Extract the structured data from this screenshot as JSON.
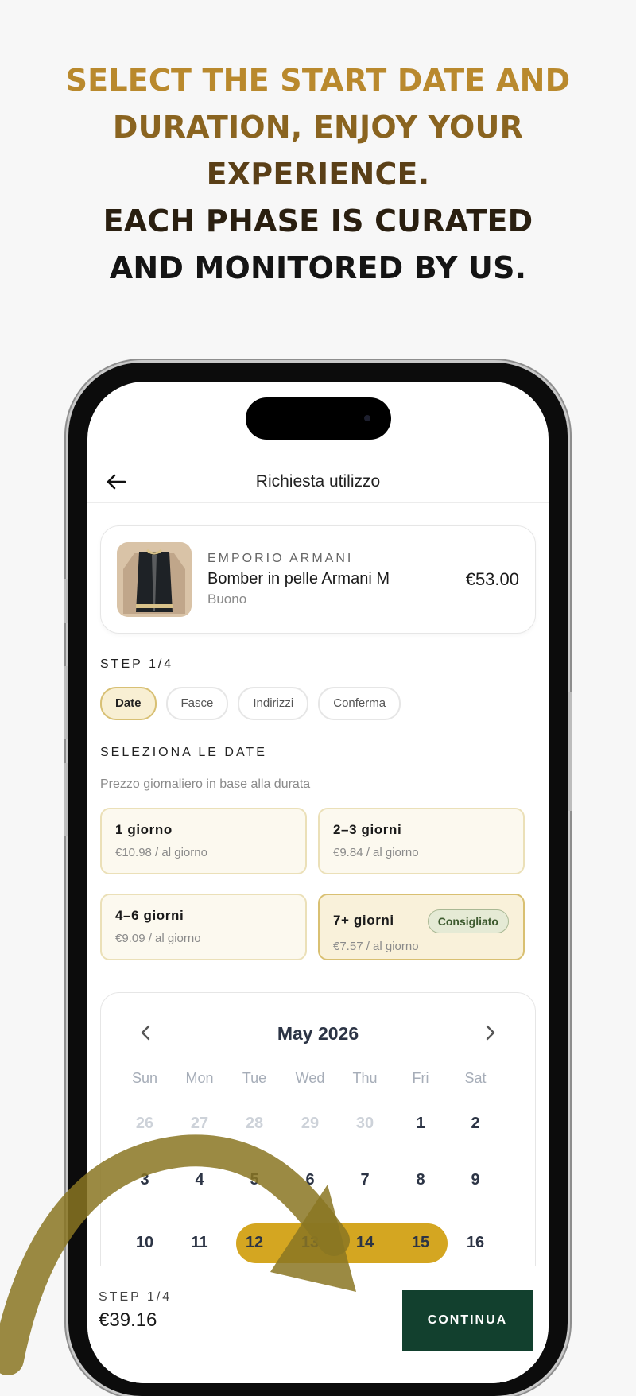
{
  "headline": {
    "line1": "SELECT THE START DATE AND",
    "line2": "DURATION, ENJOY YOUR",
    "line3": "EXPERIENCE.",
    "line4": "EACH PHASE IS CURATED",
    "line5": "AND MONITORED BY US."
  },
  "topbar": {
    "title": "Richiesta utilizzo",
    "back_icon": "arrow-left-icon"
  },
  "product": {
    "brand": "EMPORIO ARMANI",
    "name": "Bomber in pelle Armani M",
    "condition": "Buono",
    "price": "€53.00"
  },
  "steps": {
    "label": "STEP 1/4",
    "tabs": [
      "Date",
      "Fasce",
      "Indirizzi",
      "Conferma"
    ],
    "active": "Date"
  },
  "dates": {
    "title": "SELEZIONA LE DATE",
    "subtitle": "Prezzo giornaliero in base alla durata",
    "options": [
      {
        "title": "1 giorno",
        "price": "€10.98 / al giorno"
      },
      {
        "title": "2–3 giorni",
        "price": "€9.84 / al giorno"
      },
      {
        "title": "4–6 giorni",
        "price": "€9.09 / al giorno"
      },
      {
        "title": "7+ giorni",
        "price": "€7.57 / al giorno",
        "badge": "Consigliato"
      }
    ]
  },
  "calendar": {
    "month": "May 2026",
    "weekdays": [
      "Sun",
      "Mon",
      "Tue",
      "Wed",
      "Thu",
      "Fri",
      "Sat"
    ],
    "row1": [
      "26",
      "27",
      "28",
      "29",
      "30",
      "1",
      "2"
    ],
    "row2": [
      "3",
      "4",
      "5",
      "6",
      "7",
      "8",
      "9"
    ],
    "row3": [
      "10",
      "11",
      "12",
      "13",
      "14",
      "15",
      "16"
    ],
    "selected_range": [
      "12",
      "15"
    ],
    "range_color": "#d4a621"
  },
  "footer": {
    "step": "STEP 1/4",
    "total": "€39.16",
    "cta": "CONTINUA",
    "cta_color": "#12402e"
  },
  "colors": {
    "gold": "#b9892d",
    "dark": "#141414",
    "arrow": "#8a7622"
  }
}
